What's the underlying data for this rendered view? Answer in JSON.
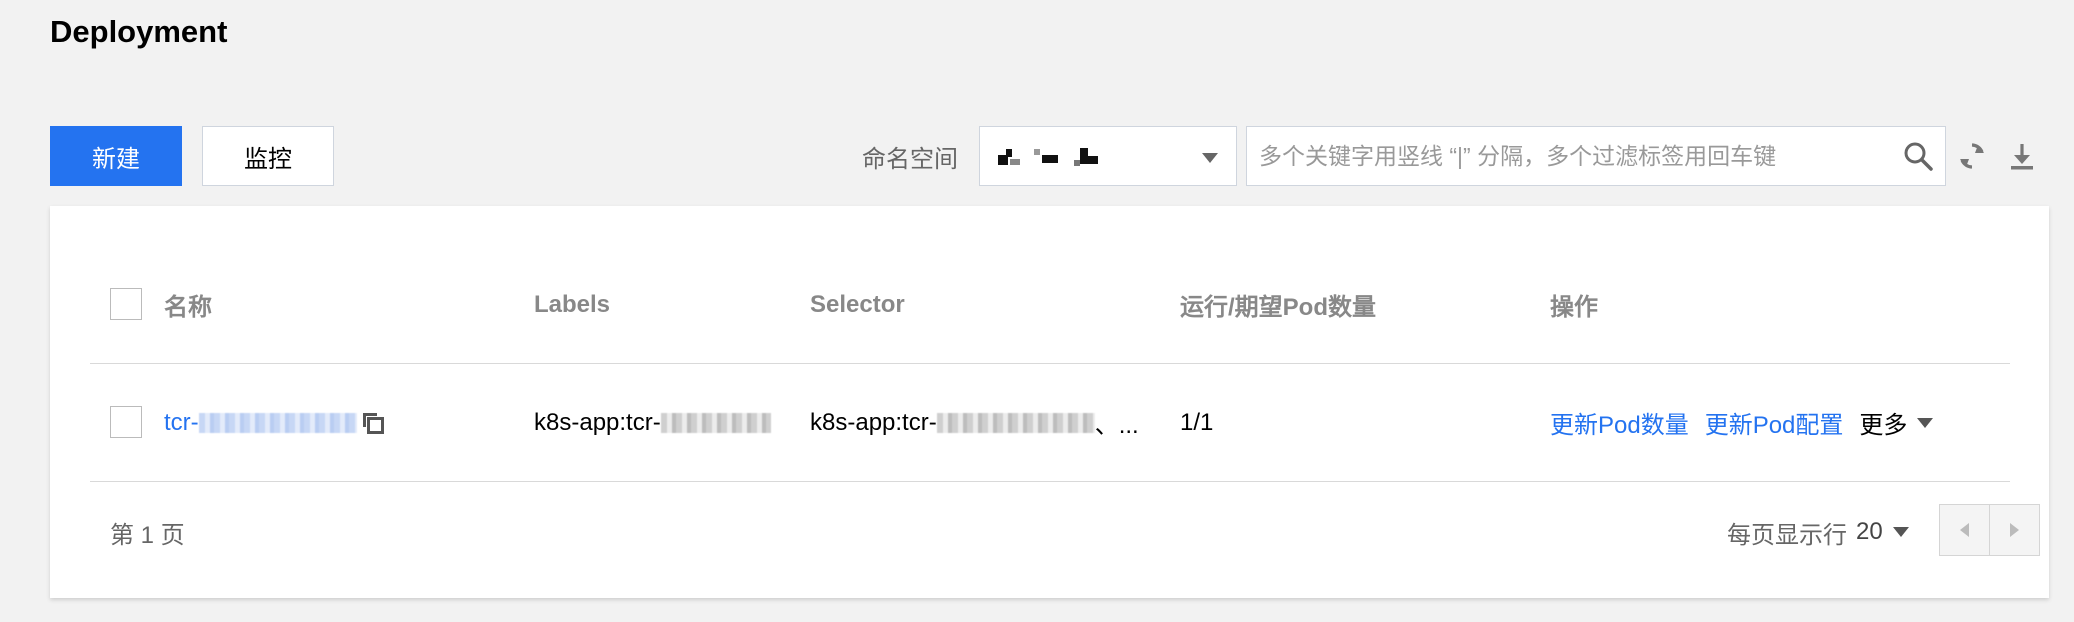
{
  "page": {
    "title": "Deployment"
  },
  "toolbar": {
    "create_label": "新建",
    "monitor_label": "监控",
    "namespace_label": "命名空间",
    "search_placeholder": "多个关键字用竖线 “|” 分隔，多个过滤标签用回车键",
    "search_value": ""
  },
  "icons": {
    "search": "search-icon",
    "refresh": "refresh-icon",
    "download": "download-icon",
    "copy": "copy-icon",
    "dropdown": "caret-down-icon"
  },
  "colors": {
    "primary": "#2473f0",
    "link": "#2473f0",
    "background": "#f2f2f2"
  },
  "table": {
    "columns": [
      "名称",
      "Labels",
      "Selector",
      "运行/期望Pod数量",
      "操作"
    ],
    "rows": [
      {
        "name_prefix": "tcr-",
        "labels_prefix": "k8s-app:tcr-",
        "selector_prefix": "k8s-app:tcr-",
        "selector_suffix": "、...",
        "pod_count": "1/1",
        "actions": [
          "更新Pod数量",
          "更新Pod配置"
        ],
        "more_label": "更多"
      }
    ]
  },
  "pagination": {
    "page_info": "第 1 页",
    "per_page_label": "每页显示行",
    "per_page_value": "20"
  }
}
